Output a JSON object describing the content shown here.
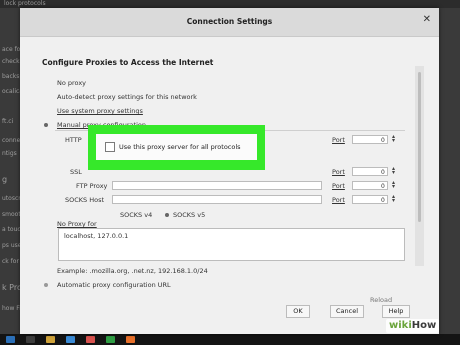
{
  "background": {
    "top_text": "lock protocols",
    "fragments": [
      "ace for op",
      "check",
      "backspace",
      "ocalicat",
      "ft.ci",
      "conne",
      "ntigs",
      "g",
      "utoscro",
      "smooth",
      "a touc",
      "ps use T",
      "ck for",
      "k Pro",
      "how Fi"
    ]
  },
  "dialog": {
    "title": "Connection Settings",
    "section_title": "Configure Proxies to Access the Internet",
    "options": {
      "no_proxy": "No proxy",
      "auto_detect": "Auto-detect proxy settings for this network",
      "system_proxy": "Use system proxy settings",
      "manual": "Manual proxy configuration"
    },
    "labels": {
      "http": "HTTP",
      "ssl": "SSL",
      "ftp": "FTP Proxy",
      "socks": "SOCKS Host",
      "port": "Port",
      "socks_v4": "SOCKS v4",
      "socks_v5": "SOCKS v5",
      "no_proxy_for": "No Proxy for"
    },
    "ports": [
      "0",
      "0",
      "0",
      "0"
    ],
    "no_proxy_value": "localhost, 127.0.0.1",
    "example": "Example: .mozilla.org, .net.nz, 192.168.1.0/24",
    "auto_config": "Automatic proxy configuration URL",
    "reload": "Reload",
    "buttons": {
      "ok": "OK",
      "cancel": "Cancel",
      "help": "Help"
    },
    "highlight_checkbox": "Use this proxy server for all protocols"
  },
  "watermark": {
    "part1": "wiki",
    "part2": "How"
  },
  "colors": {
    "highlight": "#36e82a"
  }
}
